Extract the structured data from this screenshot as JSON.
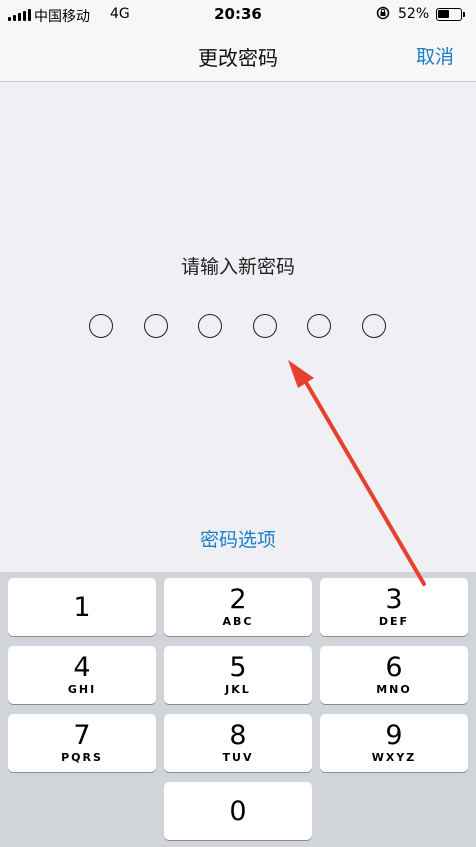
{
  "status_bar": {
    "carrier": "中国移动",
    "network": "4G",
    "time": "20:36",
    "battery_pct": "52%",
    "battery_level": 0.52
  },
  "nav": {
    "title": "更改密码",
    "cancel_label": "取消"
  },
  "prompt": "请输入新密码",
  "passcode": {
    "length": 6,
    "filled": 0
  },
  "options_label": "密码选项",
  "keypad": {
    "keys": [
      {
        "digit": "1",
        "letters": ""
      },
      {
        "digit": "2",
        "letters": "ABC"
      },
      {
        "digit": "3",
        "letters": "DEF"
      },
      {
        "digit": "4",
        "letters": "GHI"
      },
      {
        "digit": "5",
        "letters": "JKL"
      },
      {
        "digit": "6",
        "letters": "MNO"
      },
      {
        "digit": "7",
        "letters": "PQRS"
      },
      {
        "digit": "8",
        "letters": "TUV"
      },
      {
        "digit": "9",
        "letters": "WXYZ"
      },
      {
        "digit": "0",
        "letters": ""
      }
    ]
  },
  "colors": {
    "accent": "#1a7ec9",
    "annotation_arrow": "#e8402e"
  }
}
